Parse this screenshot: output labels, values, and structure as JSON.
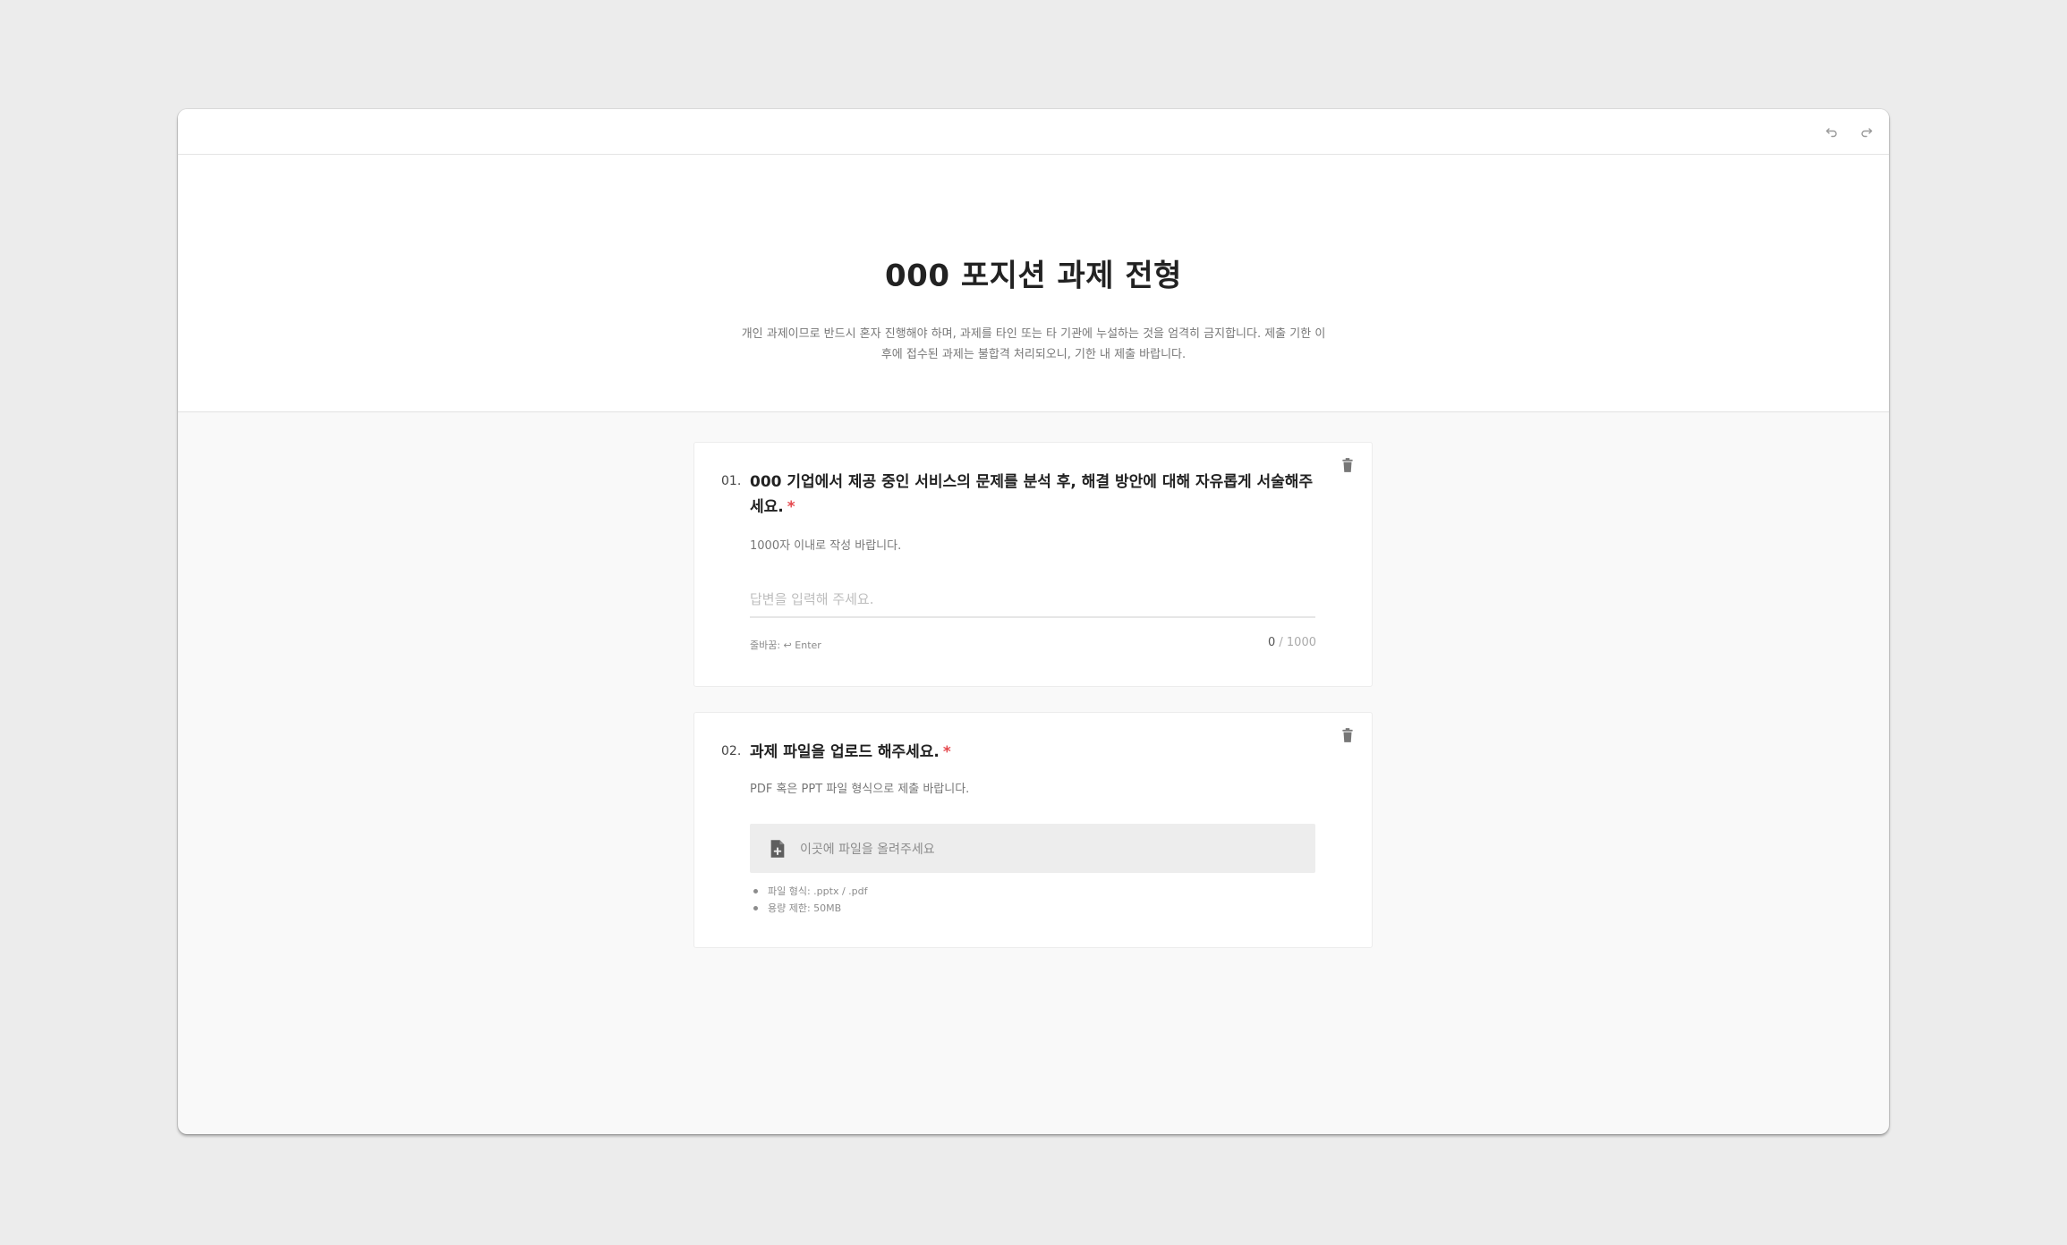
{
  "form": {
    "title": "000 포지션 과제 전형",
    "description": "개인 과제이므로 반드시 혼자 진행해야 하며, 과제를 타인 또는 타 기관에 누설하는 것을 엄격히 금지합니다. 제출 기한 이후에 접수된 과제는 불합격 처리되오니, 기한 내 제출 바랍니다."
  },
  "toolbar": {
    "undo_icon": "undo-icon",
    "redo_icon": "redo-icon"
  },
  "questions": [
    {
      "number": "01.",
      "text": "000 기업에서 제공 중인 서비스의 문제를 분석 후, 해결 방안에 대해 자유롭게 서술해주세요.",
      "required_mark": "*",
      "hint": "1000자 이내로 작성 바랍니다.",
      "answer_placeholder": "답변을 입력해 주세요.",
      "answer_value": "",
      "linebreak_hint": "줄바꿈: ↩ Enter",
      "char_count": "0",
      "char_limit": " / 1000"
    },
    {
      "number": "02.",
      "text": "과제 파일을 업로드 해주세요.",
      "required_mark": "*",
      "hint": "PDF 혹은 PPT 파일 형식으로 제출 바랍니다.",
      "dropzone_text": "이곳에 파일을 올려주세요",
      "file_notes": [
        "파일 형식: .pptx / .pdf",
        "용량 제한: 50MB"
      ]
    }
  ],
  "colors": {
    "background": "#ececec",
    "card": "#ffffff",
    "required": "#e5484d",
    "dropzone": "#ededed"
  }
}
